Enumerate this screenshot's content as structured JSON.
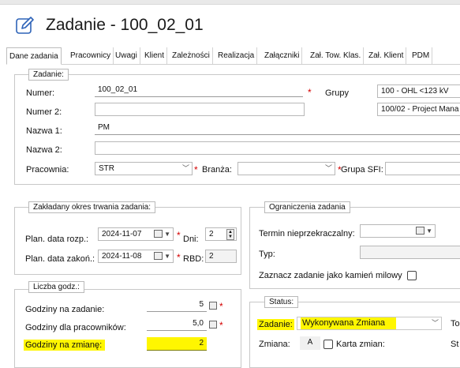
{
  "header": {
    "title": "Zadanie - 100_02_01"
  },
  "tabs": [
    "Dane zadania",
    "Pracownicy",
    "Uwagi",
    "Klient",
    "Zależności",
    "Realizacja",
    "Załączniki",
    "Zał. Tow. Klas.",
    "Zał. Klient",
    "PDM"
  ],
  "zadanie_group": {
    "legend": "Zadanie:",
    "numer_label": "Numer:",
    "numer_value": "100_02_01",
    "numer2_label": "Numer 2:",
    "numer2_value": "",
    "nazwa1_label": "Nazwa 1:",
    "nazwa1_value": "PM",
    "nazwa2_label": "Nazwa 2:",
    "nazwa2_value": "",
    "pracownia_label": "Pracownia:",
    "pracownia_value": "STR",
    "branza_label": "Branża:",
    "branza_value": "",
    "grupy_label": "Grupy",
    "grupy_value1": "100 - OHL <123 kV",
    "grupy_value2": "100/02 - Project Mana",
    "grupa_sfi_label": "Grupa SFI:",
    "grupa_sfi_value": ""
  },
  "okres_group": {
    "legend": "Zakładany okres trwania zadania:",
    "plan_rozp_label": "Plan. data rozp.:",
    "plan_rozp_value": "2024-11-07",
    "dni_label": "Dni:",
    "dni_value": "2",
    "plan_zakon_label": "Plan. data zakoń.:",
    "plan_zakon_value": "2024-11-08",
    "rbd_label": "RBD:",
    "rbd_value": "2"
  },
  "ograniczenia_group": {
    "legend": "Ograniczenia zadania",
    "termin_label": "Termin nieprzekraczalny:",
    "termin_value": "",
    "typ_label": "Typ:",
    "typ_value": "",
    "kamien_label": "Zaznacz zadanie jako kamień milowy"
  },
  "godz_group": {
    "legend": "Liczba godz.:",
    "na_zadanie_label": "Godziny na zadanie:",
    "na_zadanie_value": "5",
    "dla_prac_label": "Godziny dla pracowników:",
    "dla_prac_value": "5,0",
    "na_zmiane_label": "Godziny na zmianę:",
    "na_zmiane_value": "2"
  },
  "status_group": {
    "legend": "Status:",
    "zadanie_label": "Zadanie:",
    "zadanie_value": "Wykonywana Zmiana",
    "zmiana_label": "Zmiana:",
    "zmiana_value": "A",
    "karta_label": "Karta zmian:",
    "cut_label1": "To",
    "cut_label2": "St"
  },
  "highlight_color": "#fff600",
  "required_color": "#d40000"
}
